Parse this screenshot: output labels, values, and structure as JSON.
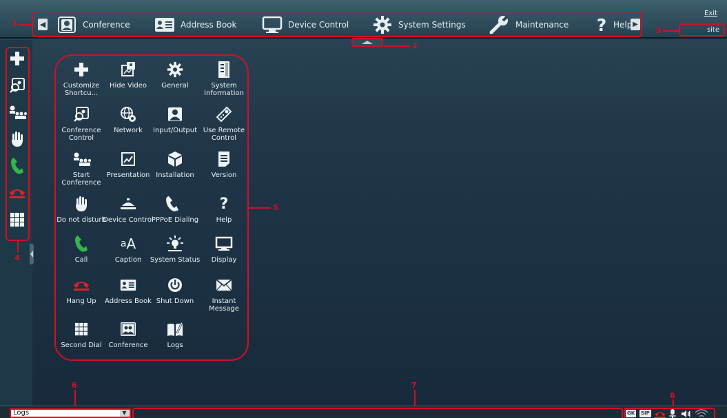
{
  "top_nav": {
    "tabs": [
      {
        "label": "Conference",
        "icon": "conference-icon"
      },
      {
        "label": "Address Book",
        "icon": "address-book-icon"
      },
      {
        "label": "Device Control",
        "icon": "monitor-icon"
      },
      {
        "label": "System Settings",
        "icon": "gear-icon"
      },
      {
        "label": "Maintenance",
        "icon": "wrench-icon"
      },
      {
        "label": "Help",
        "icon": "question-icon"
      }
    ],
    "exit_label": "Exit",
    "site_label": "site"
  },
  "left_toolbar": {
    "items": [
      "plus-icon",
      "conference-control-icon",
      "start-conference-icon",
      "do-not-disturb-icon",
      "call-icon",
      "hang-up-icon",
      "second-dial-icon"
    ]
  },
  "shortcuts": [
    {
      "label": "Customize Shortcu...",
      "icon": "plus-icon"
    },
    {
      "label": "Hide Video",
      "icon": "hide-video-icon"
    },
    {
      "label": "General",
      "icon": "gear-icon"
    },
    {
      "label": "System Information",
      "icon": "system-info-icon"
    },
    {
      "label": "Conference Control",
      "icon": "conference-control-icon"
    },
    {
      "label": "Network",
      "icon": "network-icon"
    },
    {
      "label": "Input/Output",
      "icon": "input-output-icon"
    },
    {
      "label": "Use Remote Control",
      "icon": "remote-control-icon"
    },
    {
      "label": "Start Conference",
      "icon": "start-conference-icon"
    },
    {
      "label": "Presentation",
      "icon": "presentation-icon"
    },
    {
      "label": "Installation",
      "icon": "installation-icon"
    },
    {
      "label": "Version",
      "icon": "version-icon"
    },
    {
      "label": "Do not disturb",
      "icon": "do-not-disturb-icon"
    },
    {
      "label": "Device Control",
      "icon": "device-control-icon"
    },
    {
      "label": "PPPoE Dialing",
      "icon": "pppoe-dialing-icon"
    },
    {
      "label": "Help",
      "icon": "question-icon"
    },
    {
      "label": "Call",
      "icon": "call-icon"
    },
    {
      "label": "Caption",
      "icon": "caption-icon"
    },
    {
      "label": "System Status",
      "icon": "system-status-icon"
    },
    {
      "label": "Display",
      "icon": "display-icon"
    },
    {
      "label": "Hang Up",
      "icon": "hang-up-icon"
    },
    {
      "label": "Address Book",
      "icon": "address-book-icon"
    },
    {
      "label": "Shut Down",
      "icon": "power-icon"
    },
    {
      "label": "Instant Message",
      "icon": "envelope-icon"
    },
    {
      "label": "Second Dial",
      "icon": "second-dial-icon"
    },
    {
      "label": "Conference",
      "icon": "conference-icon"
    },
    {
      "label": "Logs",
      "icon": "logs-icon"
    }
  ],
  "callouts": {
    "n1": "1",
    "n2": "2",
    "n3": "3",
    "n4": "4",
    "n5": "5",
    "n6": "6",
    "n7": "7",
    "n8": "8"
  },
  "status_bar": {
    "log_select_value": "Logs",
    "gk_label": "GK",
    "sip_label": "SIP"
  },
  "colors": {
    "callout_red": "#d40f23",
    "call_green": "#34b54a",
    "hangup_red": "#d8232a"
  }
}
